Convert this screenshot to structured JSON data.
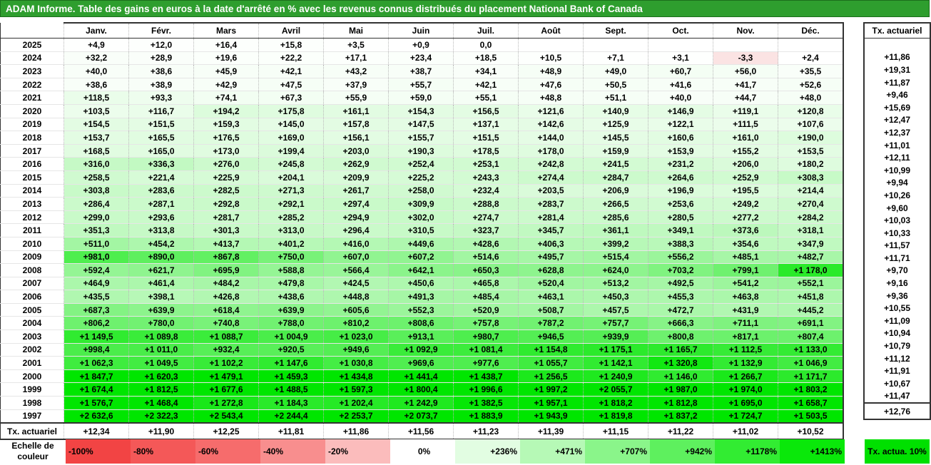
{
  "title": "ADAM Informe. Table des gains en euros à la date d'arrêté en % avec les revenus connus distribués du placement National Bank of Canada",
  "months": [
    "Janv.",
    "Févr.",
    "Mars",
    "Avril",
    "Mai",
    "Juin",
    "Juil.",
    "Août",
    "Sept.",
    "Oct.",
    "Nov.",
    "Déc."
  ],
  "rate_header": "Tx. actuariel",
  "rows": [
    {
      "year": "2025",
      "values": [
        "+4,9",
        "+12,0",
        "+16,4",
        "+15,8",
        "+3,5",
        "+0,9",
        "0,0",
        "",
        "",
        "",
        "",
        ""
      ],
      "rate": ""
    },
    {
      "year": "2024",
      "values": [
        "+32,2",
        "+28,9",
        "+19,6",
        "+22,2",
        "+17,1",
        "+23,4",
        "+18,5",
        "+10,5",
        "+7,1",
        "+3,1",
        "-3,3",
        "+2,4"
      ],
      "rate": "+11,86"
    },
    {
      "year": "2023",
      "values": [
        "+40,0",
        "+38,6",
        "+45,9",
        "+42,1",
        "+43,2",
        "+38,7",
        "+34,1",
        "+48,9",
        "+49,0",
        "+60,7",
        "+56,0",
        "+35,5"
      ],
      "rate": "+19,31"
    },
    {
      "year": "2022",
      "values": [
        "+38,6",
        "+38,9",
        "+42,9",
        "+47,5",
        "+37,9",
        "+55,7",
        "+42,1",
        "+47,6",
        "+50,5",
        "+41,6",
        "+41,7",
        "+52,6"
      ],
      "rate": "+11,87"
    },
    {
      "year": "2021",
      "values": [
        "+118,5",
        "+93,3",
        "+74,1",
        "+67,3",
        "+55,9",
        "+59,0",
        "+55,1",
        "+48,8",
        "+51,1",
        "+40,0",
        "+44,7",
        "+48,0"
      ],
      "rate": "+9,46"
    },
    {
      "year": "2020",
      "values": [
        "+103,5",
        "+116,7",
        "+194,2",
        "+175,8",
        "+161,1",
        "+154,3",
        "+156,5",
        "+121,6",
        "+140,9",
        "+146,9",
        "+119,1",
        "+120,8"
      ],
      "rate": "+15,69"
    },
    {
      "year": "2019",
      "values": [
        "+154,5",
        "+151,5",
        "+159,3",
        "+145,0",
        "+157,8",
        "+147,5",
        "+137,1",
        "+142,6",
        "+125,9",
        "+122,1",
        "+111,5",
        "+107,6"
      ],
      "rate": "+12,47"
    },
    {
      "year": "2018",
      "values": [
        "+153,7",
        "+165,5",
        "+176,5",
        "+169,0",
        "+156,1",
        "+155,7",
        "+151,5",
        "+144,0",
        "+145,5",
        "+160,6",
        "+161,0",
        "+190,0"
      ],
      "rate": "+12,37"
    },
    {
      "year": "2017",
      "values": [
        "+168,5",
        "+165,0",
        "+173,0",
        "+199,4",
        "+203,0",
        "+190,3",
        "+178,5",
        "+178,0",
        "+159,9",
        "+153,9",
        "+155,2",
        "+153,5"
      ],
      "rate": "+11,01"
    },
    {
      "year": "2016",
      "values": [
        "+316,0",
        "+336,3",
        "+276,0",
        "+245,8",
        "+262,9",
        "+252,4",
        "+253,1",
        "+242,8",
        "+241,5",
        "+231,2",
        "+206,0",
        "+180,2"
      ],
      "rate": "+12,11"
    },
    {
      "year": "2015",
      "values": [
        "+258,5",
        "+221,4",
        "+225,9",
        "+204,1",
        "+209,9",
        "+225,2",
        "+243,3",
        "+274,4",
        "+284,7",
        "+264,6",
        "+252,9",
        "+308,3"
      ],
      "rate": "+10,99"
    },
    {
      "year": "2014",
      "values": [
        "+303,8",
        "+283,6",
        "+282,5",
        "+271,3",
        "+261,7",
        "+258,0",
        "+232,4",
        "+203,5",
        "+206,9",
        "+196,9",
        "+195,5",
        "+214,4"
      ],
      "rate": "+9,94"
    },
    {
      "year": "2013",
      "values": [
        "+286,4",
        "+287,1",
        "+292,8",
        "+292,1",
        "+297,4",
        "+309,9",
        "+288,8",
        "+283,7",
        "+266,5",
        "+253,6",
        "+249,2",
        "+270,4"
      ],
      "rate": "+10,26"
    },
    {
      "year": "2012",
      "values": [
        "+299,0",
        "+293,6",
        "+281,7",
        "+285,2",
        "+294,9",
        "+302,0",
        "+274,7",
        "+281,4",
        "+285,6",
        "+280,5",
        "+277,2",
        "+284,2"
      ],
      "rate": "+9,60"
    },
    {
      "year": "2011",
      "values": [
        "+351,3",
        "+313,8",
        "+301,3",
        "+313,0",
        "+296,4",
        "+310,5",
        "+323,7",
        "+345,7",
        "+361,1",
        "+349,1",
        "+373,6",
        "+318,1"
      ],
      "rate": "+10,03"
    },
    {
      "year": "2010",
      "values": [
        "+511,0",
        "+454,2",
        "+413,7",
        "+401,2",
        "+416,0",
        "+449,6",
        "+428,6",
        "+406,3",
        "+399,2",
        "+388,3",
        "+354,6",
        "+347,9"
      ],
      "rate": "+10,33"
    },
    {
      "year": "2009",
      "values": [
        "+981,0",
        "+890,0",
        "+867,8",
        "+750,0",
        "+607,0",
        "+607,2",
        "+514,6",
        "+495,7",
        "+515,4",
        "+556,2",
        "+485,1",
        "+482,7"
      ],
      "rate": "+11,57"
    },
    {
      "year": "2008",
      "values": [
        "+592,4",
        "+621,7",
        "+695,9",
        "+588,8",
        "+566,4",
        "+642,1",
        "+650,3",
        "+628,8",
        "+624,0",
        "+703,2",
        "+799,1",
        "+1 178,0"
      ],
      "rate": "+11,71"
    },
    {
      "year": "2007",
      "values": [
        "+464,9",
        "+461,4",
        "+484,2",
        "+479,8",
        "+424,5",
        "+450,6",
        "+465,8",
        "+520,4",
        "+513,2",
        "+492,5",
        "+541,2",
        "+552,1"
      ],
      "rate": "+9,70"
    },
    {
      "year": "2006",
      "values": [
        "+435,5",
        "+398,1",
        "+426,8",
        "+438,6",
        "+448,8",
        "+491,3",
        "+485,4",
        "+463,1",
        "+450,3",
        "+455,3",
        "+463,8",
        "+451,8"
      ],
      "rate": "+9,16"
    },
    {
      "year": "2005",
      "values": [
        "+687,3",
        "+639,9",
        "+618,4",
        "+639,9",
        "+605,6",
        "+552,3",
        "+520,9",
        "+508,7",
        "+457,5",
        "+472,7",
        "+431,9",
        "+445,2"
      ],
      "rate": "+9,36"
    },
    {
      "year": "2004",
      "values": [
        "+806,2",
        "+780,0",
        "+740,8",
        "+788,0",
        "+810,2",
        "+808,6",
        "+757,8",
        "+787,2",
        "+757,7",
        "+666,3",
        "+711,1",
        "+691,1"
      ],
      "rate": "+10,55"
    },
    {
      "year": "2003",
      "values": [
        "+1 149,5",
        "+1 089,8",
        "+1 088,7",
        "+1 004,9",
        "+1 023,0",
        "+913,1",
        "+980,7",
        "+946,5",
        "+939,9",
        "+800,8",
        "+817,1",
        "+807,4"
      ],
      "rate": "+11,09"
    },
    {
      "year": "2002",
      "values": [
        "+998,4",
        "+1 011,0",
        "+932,4",
        "+920,5",
        "+949,6",
        "+1 092,9",
        "+1 081,4",
        "+1 154,8",
        "+1 175,1",
        "+1 165,7",
        "+1 112,5",
        "+1 133,0"
      ],
      "rate": "+10,94"
    },
    {
      "year": "2001",
      "values": [
        "+1 062,3",
        "+1 049,5",
        "+1 102,2",
        "+1 147,6",
        "+1 030,8",
        "+969,6",
        "+977,6",
        "+1 055,7",
        "+1 142,1",
        "+1 320,8",
        "+1 132,9",
        "+1 046,9"
      ],
      "rate": "+10,79"
    },
    {
      "year": "2000",
      "values": [
        "+1 847,7",
        "+1 620,3",
        "+1 479,1",
        "+1 459,3",
        "+1 434,8",
        "+1 441,4",
        "+1 438,7",
        "+1 256,5",
        "+1 240,9",
        "+1 146,0",
        "+1 266,7",
        "+1 171,7"
      ],
      "rate": "+11,12"
    },
    {
      "year": "1999",
      "values": [
        "+1 674,4",
        "+1 812,5",
        "+1 677,6",
        "+1 488,5",
        "+1 597,3",
        "+1 800,4",
        "+1 996,6",
        "+1 997,2",
        "+2 055,7",
        "+1 987,0",
        "+1 974,0",
        "+1 803,2"
      ],
      "rate": "+11,91"
    },
    {
      "year": "1998",
      "values": [
        "+1 576,7",
        "+1 468,4",
        "+1 272,8",
        "+1 184,3",
        "+1 202,4",
        "+1 242,9",
        "+1 382,5",
        "+1 957,1",
        "+1 818,2",
        "+1 812,8",
        "+1 695,0",
        "+1 658,7"
      ],
      "rate": "+10,67"
    },
    {
      "year": "1997",
      "values": [
        "+2 632,6",
        "+2 322,3",
        "+2 543,4",
        "+2 244,4",
        "+2 253,7",
        "+2 073,7",
        "+1 883,9",
        "+1 943,9",
        "+1 819,8",
        "+1 837,2",
        "+1 724,7",
        "+1 503,5"
      ],
      "rate": "+11,47"
    }
  ],
  "footer": {
    "label": "Tx. actuariel",
    "values": [
      "+12,34",
      "+11,90",
      "+12,25",
      "+11,81",
      "+11,86",
      "+11,56",
      "+11,23",
      "+11,39",
      "+11,15",
      "+11,22",
      "+11,02",
      "+10,52"
    ],
    "rate": "+12,76"
  },
  "legend": {
    "label": "Echelle de couleur",
    "items": [
      {
        "text": "-100%",
        "color": "#f24444"
      },
      {
        "text": "-80%",
        "color": "#f45858"
      },
      {
        "text": "-60%",
        "color": "#f66c6c"
      },
      {
        "text": "-40%",
        "color": "#f88e8e"
      },
      {
        "text": "-20%",
        "color": "#fbbcbc"
      },
      {
        "text": "0%",
        "color": "#ffffff"
      },
      {
        "text": "+236%",
        "color": "#e2fde2"
      },
      {
        "text": "+471%",
        "color": "#b6f9b6"
      },
      {
        "text": "+707%",
        "color": "#8af58a"
      },
      {
        "text": "+942%",
        "color": "#5ef05e"
      },
      {
        "text": "+1178%",
        "color": "#32ec32"
      },
      {
        "text": "+1413%",
        "color": "#0ae80a"
      }
    ],
    "act_label": "Tx. actua. 10%",
    "act_color": "#00e000"
  },
  "colors": {
    "title_bg": "#2e9e2e",
    "negative": "#fbe3e3",
    "scale_max": "#00e600"
  }
}
